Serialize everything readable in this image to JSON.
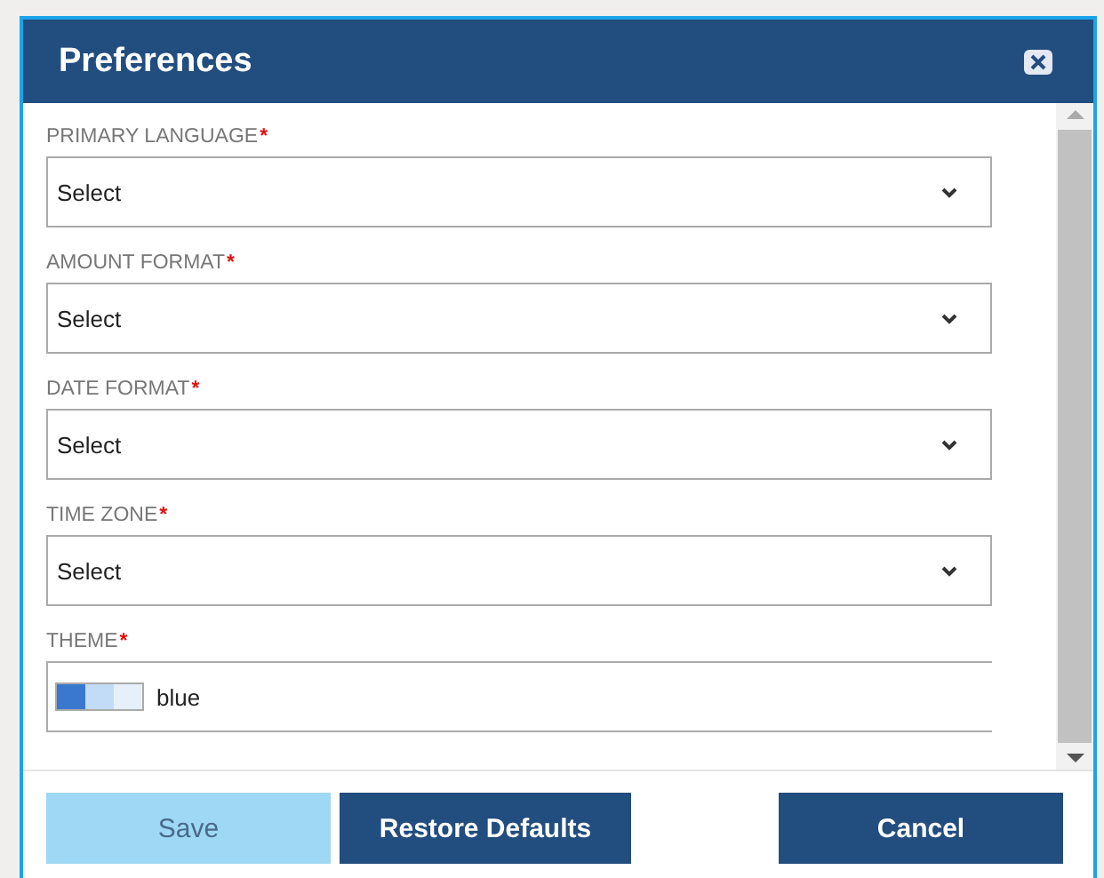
{
  "dialog": {
    "title": "Preferences"
  },
  "fields": [
    {
      "kind": "select",
      "label": "PRIMARY LANGUAGE",
      "required": true,
      "value": "Select"
    },
    {
      "kind": "select",
      "label": "AMOUNT FORMAT",
      "required": true,
      "value": "Select"
    },
    {
      "kind": "select",
      "label": "DATE FORMAT",
      "required": true,
      "value": "Select"
    },
    {
      "kind": "select",
      "label": "TIME ZONE",
      "required": true,
      "value": "Select"
    },
    {
      "kind": "theme",
      "label": "THEME",
      "required": true,
      "value": "blue"
    }
  ],
  "required_mark": "*",
  "buttons": [
    {
      "label": "Save",
      "disabled": true
    },
    {
      "label": "Restore Defaults",
      "disabled": false
    },
    {
      "label": "Cancel",
      "disabled": false
    }
  ]
}
